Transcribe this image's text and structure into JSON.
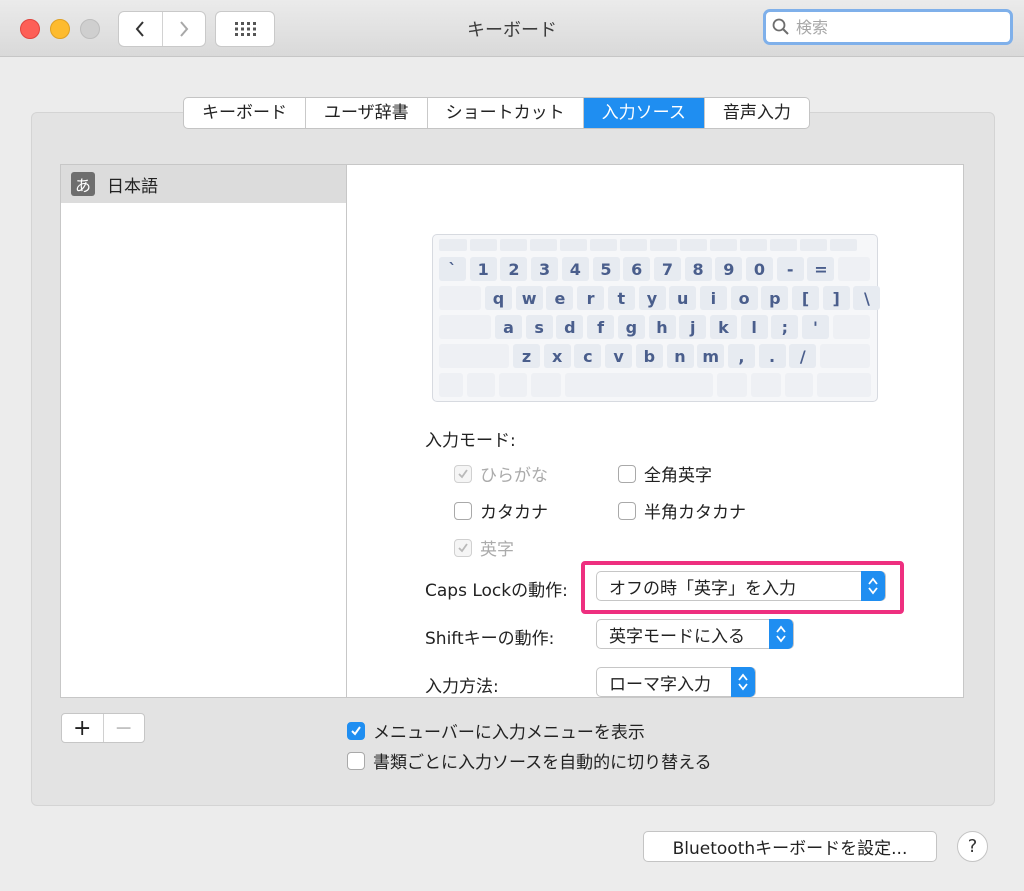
{
  "window": {
    "title": "キーボード"
  },
  "search": {
    "placeholder": "検索"
  },
  "tabs": [
    {
      "label": "キーボード"
    },
    {
      "label": "ユーザ辞書"
    },
    {
      "label": "ショートカット"
    },
    {
      "label": "入力ソース",
      "active": true
    },
    {
      "label": "音声入力"
    }
  ],
  "sources": [
    {
      "icon_text": "あ",
      "label": "日本語",
      "selected": true
    }
  ],
  "keyboard": {
    "row1": [
      "`",
      "1",
      "2",
      "3",
      "4",
      "5",
      "6",
      "7",
      "8",
      "9",
      "0",
      "-",
      "="
    ],
    "row2": [
      "q",
      "w",
      "e",
      "r",
      "t",
      "y",
      "u",
      "i",
      "o",
      "p",
      "[",
      "]",
      "\\"
    ],
    "row3": [
      "a",
      "s",
      "d",
      "f",
      "g",
      "h",
      "j",
      "k",
      "l",
      ";",
      "'"
    ],
    "row4": [
      "z",
      "x",
      "c",
      "v",
      "b",
      "n",
      "m",
      ",",
      ".",
      "/"
    ]
  },
  "input_mode": {
    "label": "入力モード:",
    "options": {
      "hiragana": {
        "label": "ひらがな",
        "checked": true,
        "disabled": true
      },
      "zenkaku_eiji": {
        "label": "全角英字",
        "checked": false,
        "disabled": false
      },
      "katakana": {
        "label": "カタカナ",
        "checked": false,
        "disabled": false
      },
      "hankaku_katakana": {
        "label": "半角カタカナ",
        "checked": false,
        "disabled": false
      },
      "eiji": {
        "label": "英字",
        "checked": true,
        "disabled": true
      }
    }
  },
  "caps_lock": {
    "label": "Caps Lockの動作:",
    "value": "オフの時「英字」を入力"
  },
  "shift": {
    "label": "Shiftキーの動作:",
    "value": "英字モードに入る"
  },
  "input_method": {
    "label": "入力方法:",
    "value": "ローマ字入力"
  },
  "list_controls": {
    "add": "+",
    "remove": "−"
  },
  "options": {
    "show_menu": {
      "label": "メニューバーに入力メニューを表示",
      "checked": true
    },
    "auto_switch": {
      "label": "書類ごとに入力ソースを自動的に切り替える",
      "checked": false
    }
  },
  "bluetooth_button": "Bluetoothキーボードを設定...",
  "help_button": "?",
  "colors": {
    "accent": "#1f8ef1",
    "highlight": "#ee2f7f"
  }
}
